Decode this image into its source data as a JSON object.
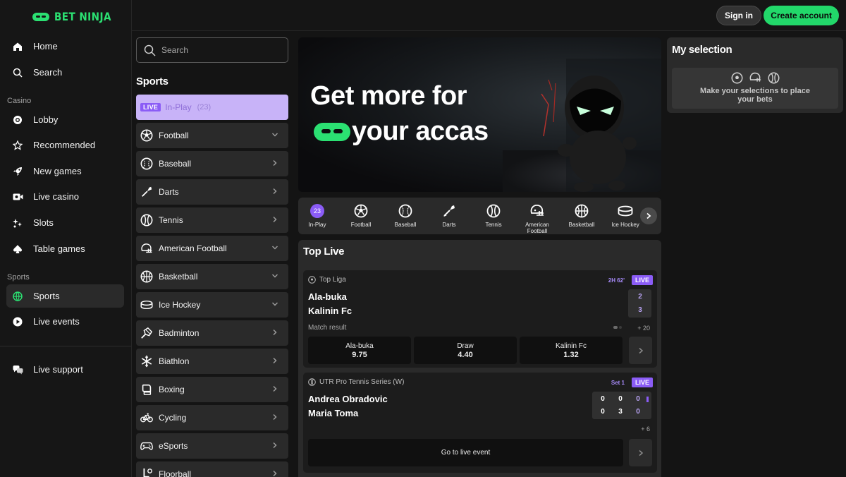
{
  "brand": {
    "name": "BET NINJA",
    "accent": "#2be072"
  },
  "nav": {
    "home": "Home",
    "search": "Search",
    "casino_section": "Casino",
    "casino_items": [
      "Lobby",
      "Recommended",
      "New games",
      "Live casino",
      "Slots",
      "Table games"
    ],
    "sports_section": "Sports",
    "sports_items": [
      "Sports",
      "Live events"
    ],
    "support": "Live support",
    "active": "Sports"
  },
  "header": {
    "signin": "Sign in",
    "create_account": "Create account"
  },
  "sidebar": {
    "search_placeholder": "Search",
    "title": "Sports",
    "inplay": {
      "badge": "LIVE",
      "label": "In-Play",
      "count": "(23)"
    },
    "sports": [
      {
        "label": "Football",
        "icon": "football-icon",
        "chevron": "down"
      },
      {
        "label": "Baseball",
        "icon": "baseball-icon",
        "chevron": "right"
      },
      {
        "label": "Darts",
        "icon": "darts-icon",
        "chevron": "right"
      },
      {
        "label": "Tennis",
        "icon": "tennis-icon",
        "chevron": "right"
      },
      {
        "label": "American Football",
        "icon": "american-football-icon",
        "chevron": "down"
      },
      {
        "label": "Basketball",
        "icon": "basketball-icon",
        "chevron": "down"
      },
      {
        "label": "Ice Hockey",
        "icon": "ice-hockey-icon",
        "chevron": "down"
      },
      {
        "label": "Badminton",
        "icon": "badminton-icon",
        "chevron": "right"
      },
      {
        "label": "Biathlon",
        "icon": "biathlon-icon",
        "chevron": "right"
      },
      {
        "label": "Boxing",
        "icon": "boxing-icon",
        "chevron": "right"
      },
      {
        "label": "Cycling",
        "icon": "cycling-icon",
        "chevron": "right"
      },
      {
        "label": "eSports",
        "icon": "esports-icon",
        "chevron": "right"
      },
      {
        "label": "Floorball",
        "icon": "floorball-icon",
        "chevron": "right"
      }
    ]
  },
  "hero": {
    "line1": "Get more for",
    "line2": "your accas"
  },
  "categories": {
    "inplay_count": "23",
    "items": [
      "In-Play",
      "Football",
      "Baseball",
      "Darts",
      "Tennis",
      "American Football",
      "Basketball",
      "Ice Hockey"
    ]
  },
  "top_live": {
    "title": "Top Live",
    "matches": [
      {
        "league": "Top Liga",
        "period": "2H 62'",
        "live": "LIVE",
        "home": "Ala-buka",
        "away": "Kalinin Fc",
        "home_score": "2",
        "away_score": "3",
        "market": "Match result",
        "more": "+ 20",
        "odds": [
          {
            "label": "Ala-buka",
            "value": "9.75"
          },
          {
            "label": "Draw",
            "value": "4.40"
          },
          {
            "label": "Kalinin Fc",
            "value": "1.32"
          }
        ]
      },
      {
        "league": "UTR Pro Tennis Series (W)",
        "period": "Set 1",
        "live": "LIVE",
        "home": "Andrea Obradovic",
        "away": "Maria Toma",
        "home_scores": [
          "0",
          "0",
          "0"
        ],
        "away_scores": [
          "0",
          "3",
          "0"
        ],
        "more": "+ 6",
        "goto": "Go to live event"
      }
    ]
  },
  "my_selection": {
    "title": "My selection",
    "empty_text": "Make your selections to place your bets"
  }
}
